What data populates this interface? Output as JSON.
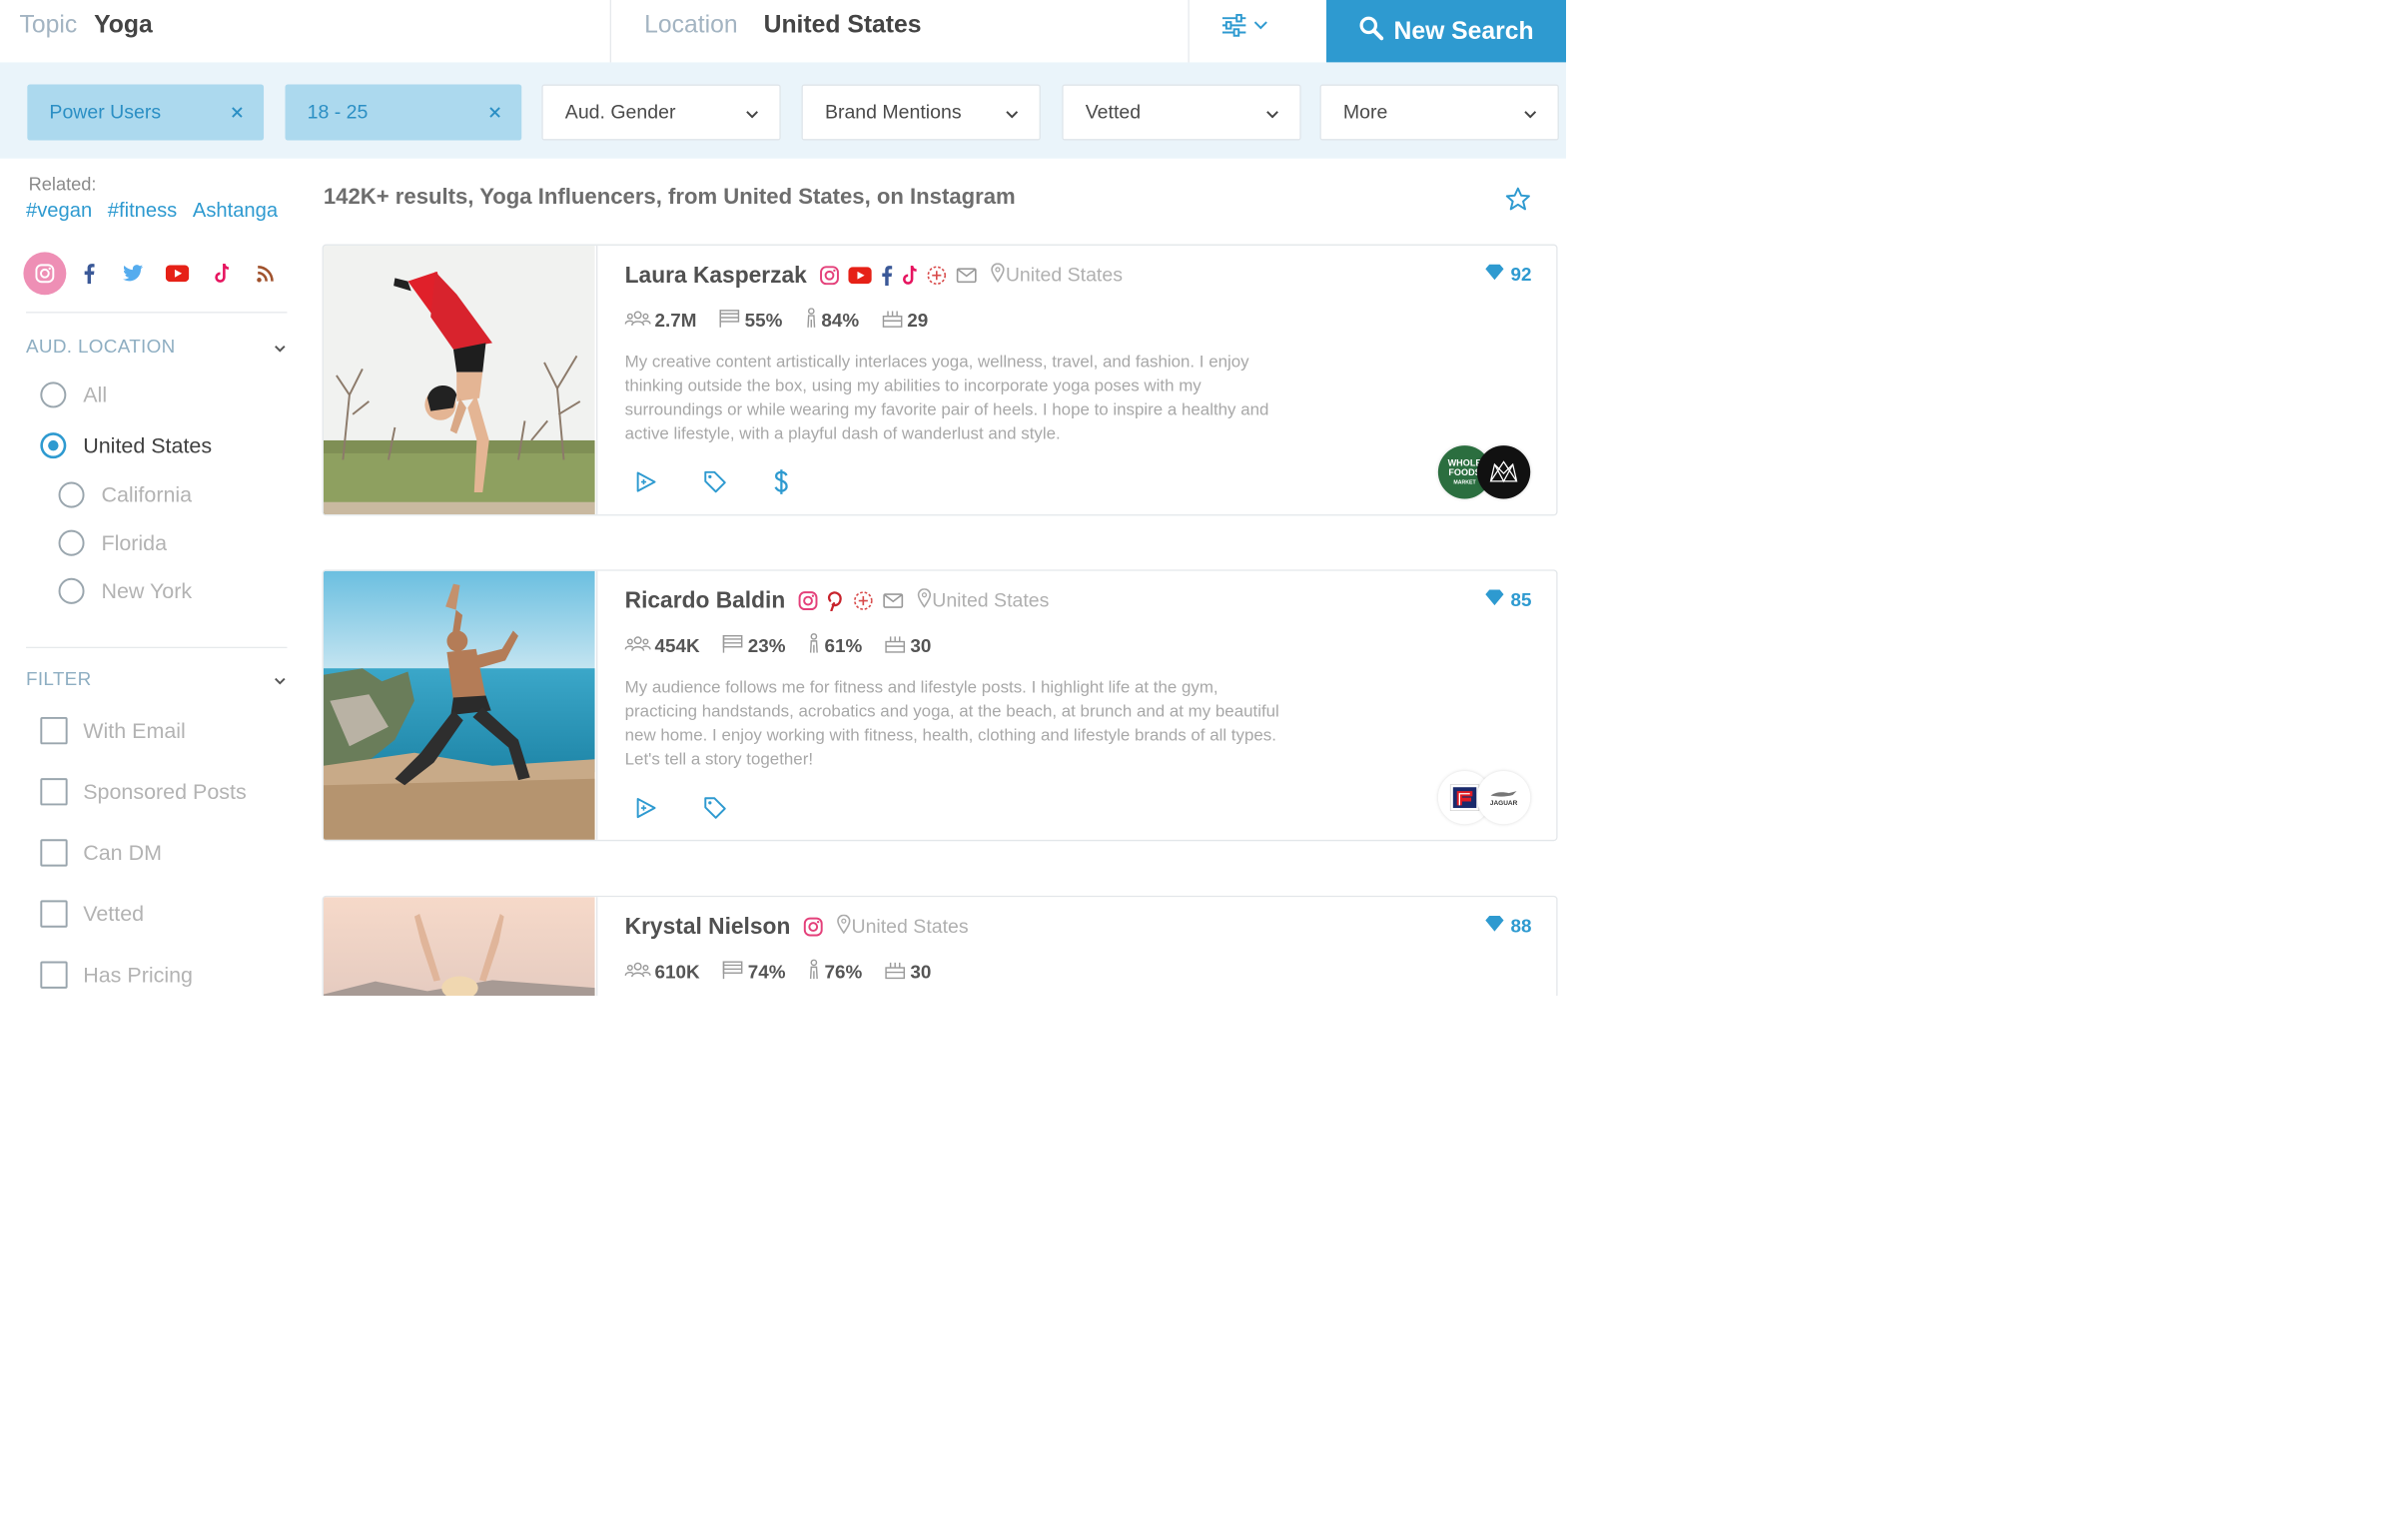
{
  "search": {
    "topic_label": "Topic",
    "topic_value": "Yoga",
    "location_label": "Location",
    "location_value": "United States",
    "new_search_label": "New Search"
  },
  "filters": {
    "active": [
      "Power Users",
      "18 - 25"
    ],
    "dropdowns": [
      "Aud. Gender",
      "Brand Mentions",
      "Vetted",
      "More"
    ]
  },
  "sidebar": {
    "related_label": "Related:",
    "related_tags": [
      "#vegan",
      "#fitness",
      "Ashtanga"
    ],
    "platforms": [
      "instagram-icon",
      "facebook-icon",
      "twitter-icon",
      "youtube-icon",
      "tiktok-icon",
      "rss-icon"
    ],
    "selected_platform": "instagram-icon",
    "aud_location": {
      "title": "AUD. LOCATION",
      "options": [
        {
          "label": "All",
          "selected": false
        },
        {
          "label": "United States",
          "selected": true
        },
        {
          "label": "California",
          "selected": false
        },
        {
          "label": "Florida",
          "selected": false
        },
        {
          "label": "New York",
          "selected": false
        }
      ]
    },
    "filter": {
      "title": "FILTER",
      "options": [
        "With Email",
        "Sponsored Posts",
        "Can DM",
        "Vetted",
        "Has Pricing"
      ]
    }
  },
  "results": {
    "summary": "142K+ results, Yoga Influencers, from United States, on Instagram",
    "cards": [
      {
        "name": "Laura Kasperzak",
        "location": "United States",
        "followers": "2.7M",
        "audience_pct": "55%",
        "gender_pct": "84%",
        "age": "29",
        "score": "92",
        "bio": "My creative content artistically interlaces yoga, wellness, travel, and fashion. I enjoy thinking outside the box, using my abilities to incorporate yoga poses with my surroundings or while wearing my favorite pair of heels. I hope to inspire a healthy and active lifestyle, with a playful dash of wanderlust and style.",
        "brand_logo_text": [
          "WHOLE FOODS",
          "MARKET"
        ]
      },
      {
        "name": "Ricardo Baldin",
        "location": "United States",
        "followers": "454K",
        "audience_pct": "23%",
        "gender_pct": "61%",
        "age": "30",
        "score": "85",
        "bio": "My audience follows me for fitness and lifestyle posts. I highlight life at the gym, practicing handstands, acrobatics and yoga, at the beach, at brunch and at my beautiful new home. I enjoy working with fitness, health, clothing and lifestyle brands of all types. Let's tell a story together!",
        "brand_logo_text": [
          "JAGUAR"
        ]
      },
      {
        "name": "Krystal Nielson",
        "location": "United States",
        "followers": "610K",
        "audience_pct": "74%",
        "gender_pct": "76%",
        "age": "30",
        "score": "88"
      }
    ]
  },
  "colors": {
    "accent": "#2e9ad0",
    "active_chip_bg": "#acd9ee",
    "filter_band_bg": "#eaf4fa",
    "instagram_pink": "#ee8fb5"
  }
}
